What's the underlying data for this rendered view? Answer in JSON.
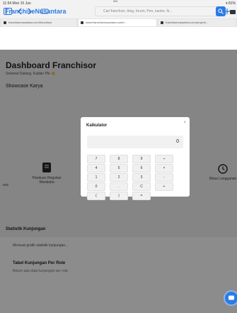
{
  "statusbar": {
    "time": "11:54  Mon 15 Jun",
    "dots": "•••",
    "battery": "▾ 81%"
  },
  "browser": {
    "url": "franchisenusantara.com",
    "tabs": [
      "franchisenusantara.com/franchisor",
      "www.franchisenusantara.com/f...",
      "franchisenusantara.com/project/..."
    ]
  },
  "header": {
    "brand": "FranchiseNusantara",
    "search_placeholder": "Cari franchise, blog, forum, Pen, kantor, N..."
  },
  "page": {
    "title": "Dashboard Franchisor",
    "welcome": "Selamat Datang, Kaidan Ple 👋",
    "showcase": "Showcase Karya",
    "features": [
      "ons",
      "Panduan Regulasi Waralaba",
      "Masa Langganan"
    ],
    "stats_title": "Statistik Kunjungan",
    "stats_loading": "Memuat grafik statistik kunjungan...",
    "role_title": "Tabel Kunjungan Per Role",
    "role_empty": "Belum ada data kunjungan per role."
  },
  "calculator": {
    "title": "Kalkulator",
    "close": "×",
    "display": "0",
    "keys": [
      [
        "7",
        "8",
        "9",
        "÷"
      ],
      [
        "4",
        "5",
        "6",
        "×"
      ],
      [
        "1",
        "2",
        "3",
        "-"
      ],
      [
        "0",
        ".",
        "C",
        "+"
      ],
      [
        "(",
        ")",
        "="
      ]
    ]
  }
}
